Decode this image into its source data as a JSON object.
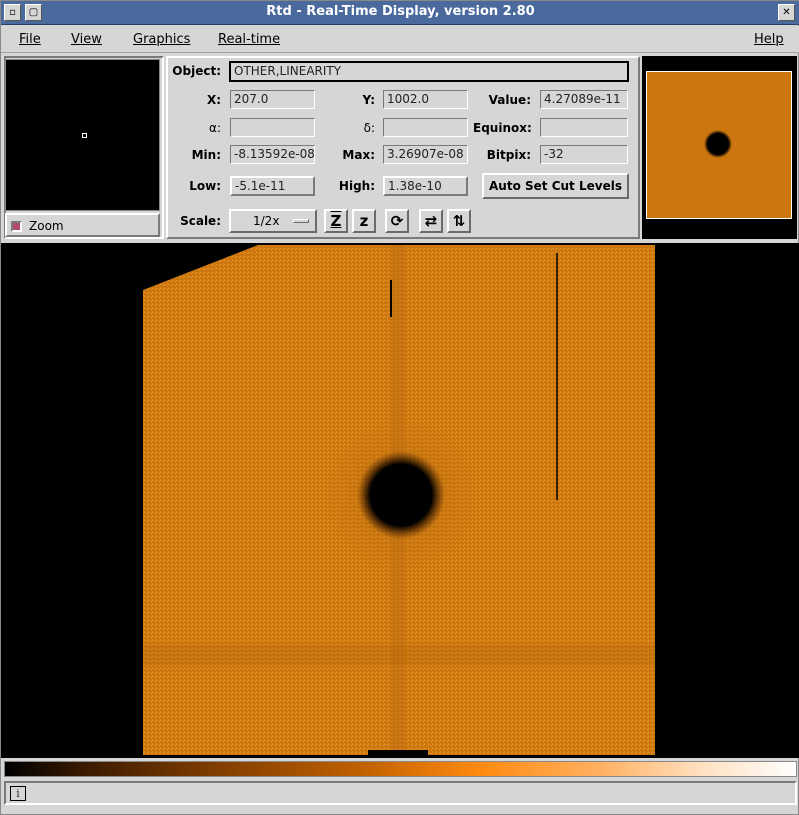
{
  "window": {
    "title": "Rtd - Real-Time Display, version 2.80"
  },
  "menu": {
    "file": "File",
    "view": "View",
    "graphics": "Graphics",
    "realtime": "Real-time",
    "help": "Help"
  },
  "zoom": {
    "label": "Zoom",
    "checked": true
  },
  "info": {
    "object_label": "Object:",
    "object_value": "OTHER,LINEARITY",
    "x_label": "X:",
    "x_value": "207.0",
    "y_label": "Y:",
    "y_value": "1002.0",
    "value_label": "Value:",
    "value_value": "4.27089e-11",
    "alpha_label": "α:",
    "alpha_value": "",
    "delta_label": "δ:",
    "delta_value": "",
    "equinox_label": "Equinox:",
    "equinox_value": "",
    "min_label": "Min:",
    "min_value": "-8.13592e-08",
    "max_label": "Max:",
    "max_value": "3.26907e-08",
    "bitpix_label": "Bitpix:",
    "bitpix_value": "-32",
    "low_label": "Low:",
    "low_value": "-5.1e-11",
    "high_label": "High:",
    "high_value": "1.38e-10",
    "autoset_label": "Auto Set Cut Levels",
    "scale_label": "Scale:",
    "scale_value": "1/2x"
  },
  "toolbar_icons": {
    "zoom_in": "Z",
    "zoom_out": "z",
    "rotate": "⟳",
    "flip_x": "⇄",
    "flip_y": "⇅"
  },
  "status": {
    "icon": "i",
    "text": ""
  },
  "colors": {
    "image_orange": "#d07a10",
    "title_bar": "#4a6a9e",
    "panel_bg": "#d6d6d6"
  }
}
